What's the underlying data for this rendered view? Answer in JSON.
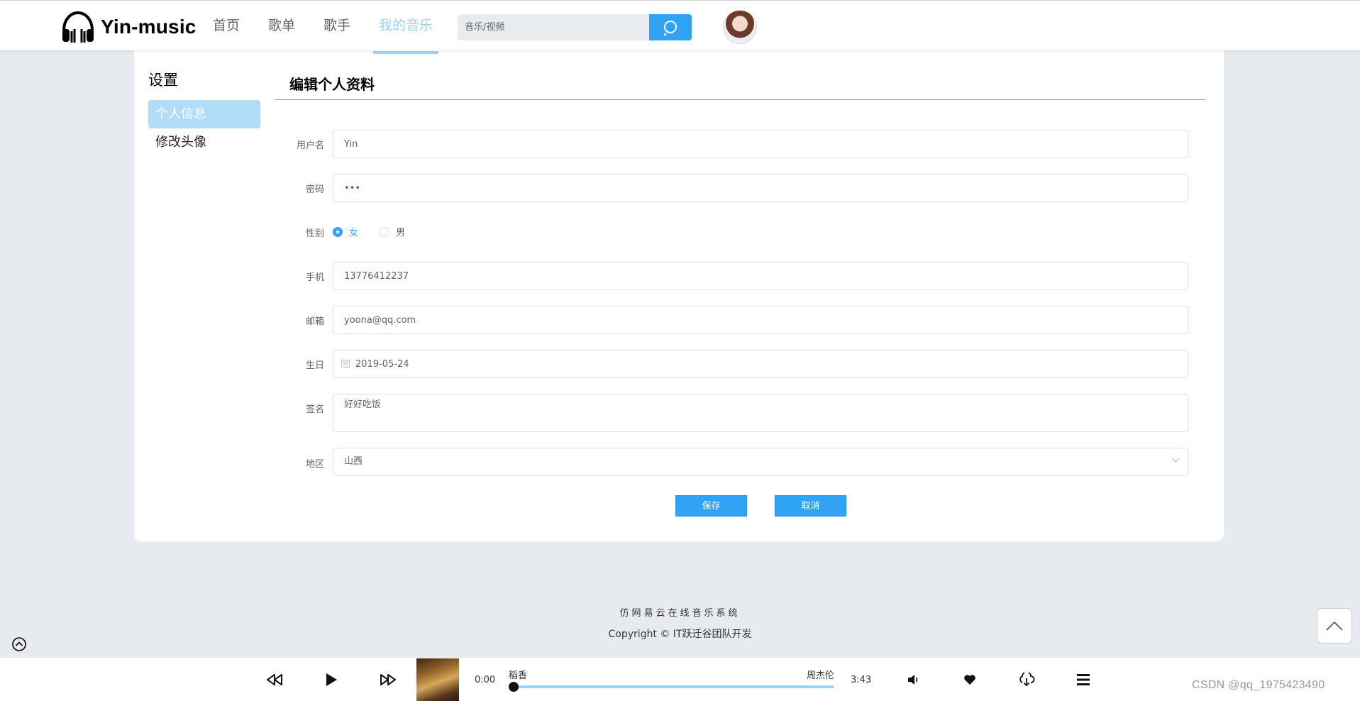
{
  "header": {
    "logo_text": "Yin-music",
    "nav": [
      {
        "label": "首页",
        "active": false
      },
      {
        "label": "歌单",
        "active": false
      },
      {
        "label": "歌手",
        "active": false
      },
      {
        "label": "我的音乐",
        "active": true
      }
    ],
    "search_placeholder": "音乐/视频"
  },
  "sidebar": {
    "title": "设置",
    "items": [
      {
        "label": "个人信息",
        "active": true
      },
      {
        "label": "修改头像",
        "active": false
      }
    ]
  },
  "form": {
    "title": "编辑个人资料",
    "username_label": "用户名",
    "username_value": "Yin",
    "password_label": "密码",
    "password_value": "yin",
    "gender_label": "性别",
    "gender_options": [
      "女",
      "男"
    ],
    "gender_selected": "女",
    "phone_label": "手机",
    "phone_value": "13776412237",
    "email_label": "邮箱",
    "email_value": "yoona@qq.com",
    "birthday_label": "生日",
    "birthday_value": "2019-05-24",
    "signature_label": "签名",
    "signature_value": "好好吃饭",
    "region_label": "地区",
    "region_value": "山西",
    "save_label": "保存",
    "cancel_label": "取消"
  },
  "footer": {
    "line1": "仿网易云在线音乐系统",
    "line2": "Copyright © IT跃迁谷团队开发"
  },
  "player": {
    "current_time": "0:00",
    "total_time": "3:43",
    "song": "稻香",
    "singer": "周杰伦",
    "progress": 0
  },
  "watermark": "CSDN @qq_1975423490",
  "colors": {
    "accent": "#30a3f5",
    "nav_active": "#9ecff2",
    "sidebar_active": "#b1dcf8",
    "background": "#e7ebef"
  }
}
